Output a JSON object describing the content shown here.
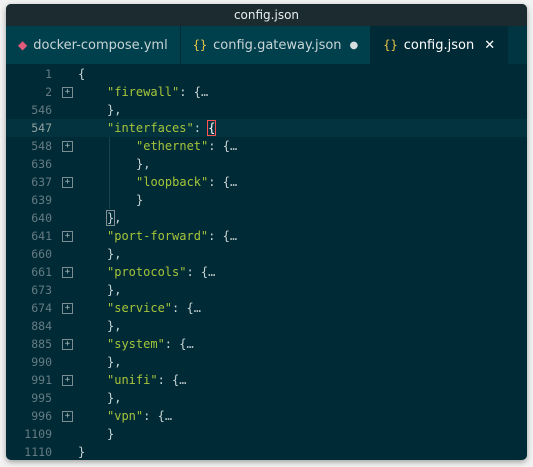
{
  "window": {
    "title": "config.json"
  },
  "tabs": [
    {
      "label": "docker-compose.yml",
      "icon": "docker-icon"
    },
    {
      "label": "config.gateway.json",
      "icon": "json-icon",
      "dirty": true
    },
    {
      "label": "config.json",
      "icon": "json-icon",
      "active": true
    }
  ],
  "icons": {
    "json": "{}",
    "dirty": "●",
    "close": "✕",
    "fold": "+",
    "ellipsis": "…"
  },
  "lines": [
    {
      "no": "1",
      "indent": 0,
      "segments": [
        {
          "t": "{",
          "c": "punc"
        }
      ]
    },
    {
      "no": "2",
      "indent": 1,
      "fold": true,
      "segments": [
        {
          "t": "\"firewall\"",
          "c": "str"
        },
        {
          "t": ": {",
          "c": "punc"
        },
        {
          "t": "…",
          "c": "ell"
        }
      ]
    },
    {
      "no": "546",
      "indent": 1,
      "segments": [
        {
          "t": "},",
          "c": "punc"
        }
      ]
    },
    {
      "no": "547",
      "indent": 1,
      "current": true,
      "segments": [
        {
          "t": "\"interfaces\"",
          "c": "str"
        },
        {
          "t": ": ",
          "c": "punc"
        },
        {
          "t": "{",
          "c": "bm"
        }
      ]
    },
    {
      "no": "548",
      "indent": 2,
      "fold": true,
      "segments": [
        {
          "t": "\"ethernet\"",
          "c": "str"
        },
        {
          "t": ": {",
          "c": "punc"
        },
        {
          "t": "…",
          "c": "ell"
        }
      ]
    },
    {
      "no": "636",
      "indent": 2,
      "segments": [
        {
          "t": "},",
          "c": "punc"
        }
      ]
    },
    {
      "no": "637",
      "indent": 2,
      "fold": true,
      "segments": [
        {
          "t": "\"loopback\"",
          "c": "str"
        },
        {
          "t": ": {",
          "c": "punc"
        },
        {
          "t": "…",
          "c": "ell"
        }
      ]
    },
    {
      "no": "639",
      "indent": 2,
      "segments": [
        {
          "t": "}",
          "c": "punc"
        }
      ]
    },
    {
      "no": "640",
      "indent": 1,
      "segments": [
        {
          "t": "}",
          "c": "bm2"
        },
        {
          "t": ",",
          "c": "punc"
        }
      ]
    },
    {
      "no": "641",
      "indent": 1,
      "fold": true,
      "segments": [
        {
          "t": "\"port-forward\"",
          "c": "str"
        },
        {
          "t": ": {",
          "c": "punc"
        },
        {
          "t": "…",
          "c": "ell"
        }
      ]
    },
    {
      "no": "660",
      "indent": 1,
      "segments": [
        {
          "t": "},",
          "c": "punc"
        }
      ]
    },
    {
      "no": "661",
      "indent": 1,
      "fold": true,
      "segments": [
        {
          "t": "\"protocols\"",
          "c": "str"
        },
        {
          "t": ": {",
          "c": "punc"
        },
        {
          "t": "…",
          "c": "ell"
        }
      ]
    },
    {
      "no": "673",
      "indent": 1,
      "segments": [
        {
          "t": "},",
          "c": "punc"
        }
      ]
    },
    {
      "no": "674",
      "indent": 1,
      "fold": true,
      "segments": [
        {
          "t": "\"service\"",
          "c": "str"
        },
        {
          "t": ": {",
          "c": "punc"
        },
        {
          "t": "…",
          "c": "ell"
        }
      ]
    },
    {
      "no": "884",
      "indent": 1,
      "segments": [
        {
          "t": "},",
          "c": "punc"
        }
      ]
    },
    {
      "no": "885",
      "indent": 1,
      "fold": true,
      "segments": [
        {
          "t": "\"system\"",
          "c": "str"
        },
        {
          "t": ": {",
          "c": "punc"
        },
        {
          "t": "…",
          "c": "ell"
        }
      ]
    },
    {
      "no": "990",
      "indent": 1,
      "segments": [
        {
          "t": "},",
          "c": "punc"
        }
      ]
    },
    {
      "no": "991",
      "indent": 1,
      "fold": true,
      "segments": [
        {
          "t": "\"unifi\"",
          "c": "str"
        },
        {
          "t": ": {",
          "c": "punc"
        },
        {
          "t": "…",
          "c": "ell"
        }
      ]
    },
    {
      "no": "995",
      "indent": 1,
      "segments": [
        {
          "t": "},",
          "c": "punc"
        }
      ]
    },
    {
      "no": "996",
      "indent": 1,
      "fold": true,
      "segments": [
        {
          "t": "\"vpn\"",
          "c": "str"
        },
        {
          "t": ": {",
          "c": "punc"
        },
        {
          "t": "…",
          "c": "ell"
        }
      ]
    },
    {
      "no": "1109",
      "indent": 1,
      "segments": [
        {
          "t": "}",
          "c": "punc"
        }
      ]
    },
    {
      "no": "1110",
      "indent": 0,
      "segments": [
        {
          "t": "}",
          "c": "punc"
        }
      ]
    }
  ]
}
